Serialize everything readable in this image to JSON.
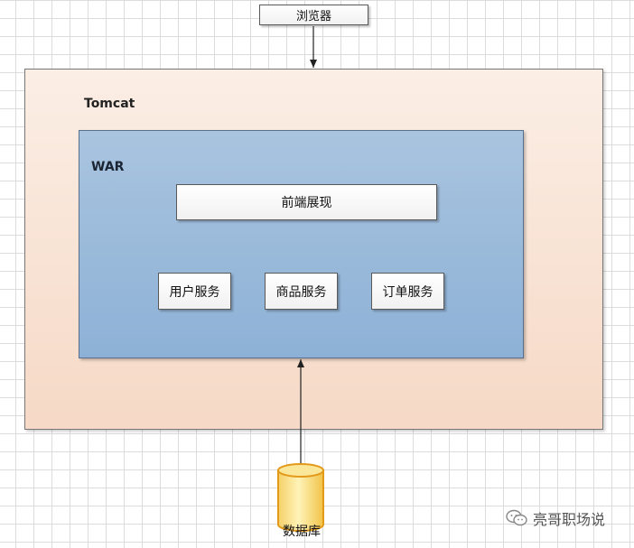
{
  "browser": {
    "label": "浏览器"
  },
  "tomcat": {
    "label": "Tomcat"
  },
  "war": {
    "label": "WAR",
    "frontend": "前端展现",
    "services": [
      "用户服务",
      "商品服务",
      "订单服务"
    ]
  },
  "database": {
    "label": "数据库"
  },
  "watermark": {
    "text": "亮哥职场说"
  },
  "colors": {
    "tomcat_fill": "#f8e3d6",
    "war_fill": "#9bbbdc",
    "database_fill": "#f5cc55"
  }
}
